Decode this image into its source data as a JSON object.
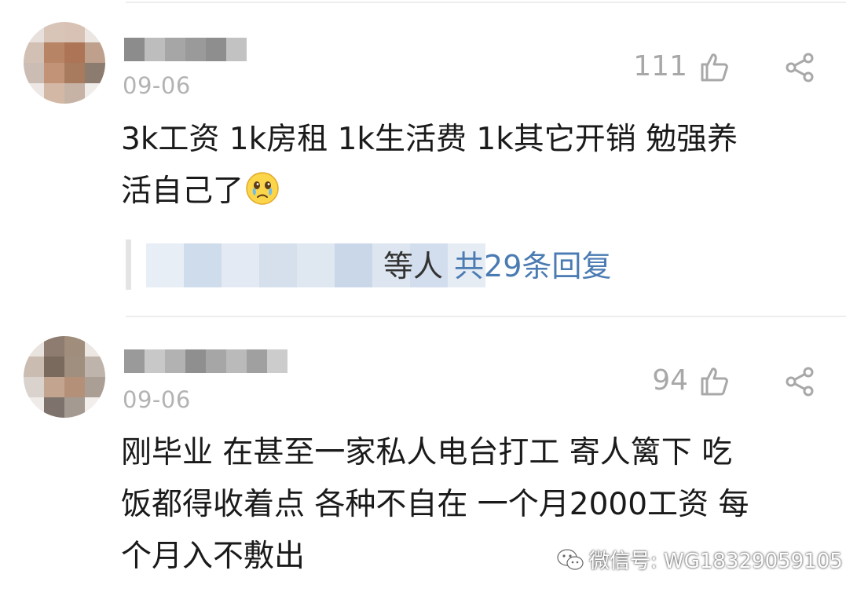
{
  "comments": [
    {
      "date": "09-06",
      "likes": "111",
      "text_line1": "3k工资 1k房租 1k生活费 1k其它开销 勉强养",
      "text_line2": "活自己了",
      "emoji": "crying-face",
      "reply_suffix": "等人",
      "reply_count": "共29条回复"
    },
    {
      "date": "09-06",
      "likes": "94",
      "text_line1": "刚毕业 在甚至一家私人电台打工 寄人篱下 吃",
      "text_line2": "饭都得收着点 各种不自在 一个月2000工资 每",
      "text_line3": "个月入不敷出"
    }
  ],
  "watermark": {
    "label": "微信号: WG18329059105"
  },
  "icons": {
    "like": "thumbs-up-icon",
    "share": "share-icon",
    "wechat": "wechat-icon"
  }
}
